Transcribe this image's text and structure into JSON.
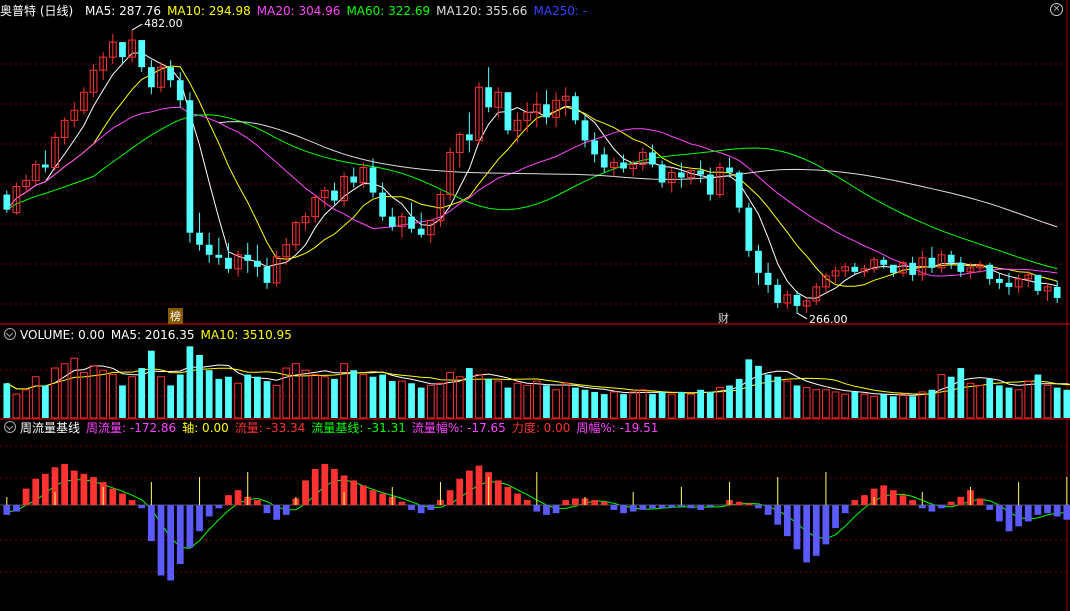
{
  "price_panel": {
    "title": "奥普特 (日线)",
    "ma": [
      {
        "label": "MA5: 287.76",
        "color": "#ffffff"
      },
      {
        "label": "MA10: 294.98",
        "color": "#ffff00"
      },
      {
        "label": "MA20: 304.96",
        "color": "#ff44ff"
      },
      {
        "label": "MA60: 322.69",
        "color": "#00ff00"
      },
      {
        "label": "MA120: 355.66",
        "color": "#dddddd"
      },
      {
        "label": "MA250: -",
        "color": "#3344ff"
      }
    ],
    "high_label": "482.00",
    "low_label": "266.00",
    "tag_bang": "榜",
    "tag_cai": "财"
  },
  "volume_panel": {
    "items": [
      {
        "label": "VOLUME: 0.00",
        "color": "#ffffff"
      },
      {
        "label": "MA5: 2016.35",
        "color": "#ffffff"
      },
      {
        "label": "MA10: 3510.95",
        "color": "#ffff00"
      }
    ]
  },
  "indicator_panel": {
    "title": "周流量基线",
    "items": [
      {
        "label": "周流量: -172.86",
        "color": "#ff44ff"
      },
      {
        "label": "轴: 0.00",
        "color": "#ffff00"
      },
      {
        "label": "流量: -33.34",
        "color": "#ff3333"
      },
      {
        "label": "流量基线: -31.31",
        "color": "#00ff00"
      },
      {
        "label": "流量幅%: -17.65",
        "color": "#ff44ff"
      },
      {
        "label": "力度: 0.00",
        "color": "#ff3333"
      },
      {
        "label": "周幅%: -19.51",
        "color": "#ff44ff"
      }
    ]
  },
  "colors": {
    "up": "#ff3232",
    "down": "#54ffff",
    "grid": "#7a0000",
    "divider": "#a00000"
  },
  "chart_data": [
    {
      "type": "candlestick",
      "name": "price",
      "ohlc": [
        [
          318,
          322,
          300,
          303
        ],
        [
          300,
          330,
          298,
          326
        ],
        [
          326,
          338,
          320,
          332
        ],
        [
          332,
          352,
          328,
          348
        ],
        [
          348,
          362,
          340,
          345
        ],
        [
          345,
          380,
          342,
          375
        ],
        [
          375,
          395,
          368,
          392
        ],
        [
          392,
          410,
          385,
          402
        ],
        [
          402,
          425,
          398,
          420
        ],
        [
          420,
          448,
          415,
          442
        ],
        [
          442,
          460,
          432,
          455
        ],
        [
          455,
          478,
          448,
          470
        ],
        [
          470,
          468,
          448,
          455
        ],
        [
          455,
          482,
          450,
          472
        ],
        [
          472,
          470,
          440,
          445
        ],
        [
          445,
          452,
          418,
          425
        ],
        [
          425,
          450,
          420,
          445
        ],
        [
          445,
          452,
          425,
          432
        ],
        [
          432,
          440,
          405,
          412
        ],
        [
          412,
          420,
          270,
          280
        ],
        [
          280,
          300,
          262,
          268
        ],
        [
          268,
          280,
          250,
          258
        ],
        [
          258,
          275,
          248,
          255
        ],
        [
          255,
          270,
          240,
          244
        ],
        [
          244,
          262,
          236,
          258
        ],
        [
          258,
          270,
          240,
          252
        ],
        [
          252,
          268,
          236,
          246
        ],
        [
          246,
          255,
          224,
          230
        ],
        [
          230,
          262,
          226,
          256
        ],
        [
          256,
          275,
          248,
          268
        ],
        [
          268,
          292,
          262,
          290
        ],
        [
          290,
          300,
          282,
          296
        ],
        [
          296,
          318,
          290,
          315
        ],
        [
          315,
          326,
          305,
          322
        ],
        [
          322,
          330,
          308,
          312
        ],
        [
          312,
          340,
          306,
          336
        ],
        [
          336,
          345,
          325,
          330
        ],
        [
          330,
          350,
          325,
          345
        ],
        [
          345,
          354,
          315,
          320
        ],
        [
          320,
          330,
          292,
          296
        ],
        [
          296,
          305,
          282,
          286
        ],
        [
          286,
          300,
          275,
          296
        ],
        [
          296,
          310,
          280,
          284
        ],
        [
          284,
          300,
          275,
          278
        ],
        [
          278,
          290,
          270,
          292
        ],
        [
          292,
          322,
          286,
          318
        ],
        [
          318,
          365,
          312,
          360
        ],
        [
          360,
          380,
          345,
          378
        ],
        [
          378,
          400,
          360,
          372
        ],
        [
          372,
          430,
          368,
          425
        ],
        [
          425,
          445,
          400,
          405
        ],
        [
          405,
          425,
          395,
          420
        ],
        [
          420,
          420,
          378,
          382
        ],
        [
          382,
          400,
          370,
          392
        ],
        [
          392,
          410,
          380,
          400
        ],
        [
          400,
          420,
          385,
          408
        ],
        [
          408,
          422,
          388,
          395
        ],
        [
          395,
          420,
          385,
          412
        ],
        [
          412,
          425,
          396,
          416
        ],
        [
          416,
          420,
          388,
          392
        ],
        [
          392,
          398,
          365,
          372
        ],
        [
          372,
          380,
          350,
          358
        ],
        [
          358,
          365,
          340,
          345
        ],
        [
          345,
          355,
          336,
          350
        ],
        [
          350,
          358,
          340,
          344
        ],
        [
          344,
          352,
          336,
          348
        ],
        [
          348,
          365,
          342,
          360
        ],
        [
          360,
          368,
          345,
          348
        ],
        [
          348,
          352,
          325,
          330
        ],
        [
          330,
          345,
          320,
          340
        ],
        [
          340,
          350,
          325,
          335
        ],
        [
          335,
          345,
          328,
          342
        ],
        [
          342,
          352,
          330,
          338
        ],
        [
          338,
          345,
          312,
          318
        ],
        [
          318,
          350,
          315,
          345
        ],
        [
          345,
          355,
          335,
          340
        ],
        [
          340,
          342,
          300,
          305
        ],
        [
          305,
          310,
          256,
          262
        ],
        [
          262,
          268,
          228,
          240
        ],
        [
          240,
          250,
          220,
          228
        ],
        [
          228,
          234,
          205,
          210
        ],
        [
          210,
          222,
          204,
          218
        ],
        [
          218,
          222,
          200,
          207
        ],
        [
          207,
          215,
          200,
          212
        ],
        [
          212,
          230,
          208,
          226
        ],
        [
          226,
          240,
          220,
          237
        ],
        [
          237,
          246,
          230,
          242
        ],
        [
          242,
          250,
          236,
          246
        ],
        [
          246,
          250,
          238,
          241
        ],
        [
          241,
          248,
          236,
          244
        ],
        [
          244,
          256,
          240,
          253
        ],
        [
          253,
          256,
          244,
          248
        ],
        [
          248,
          246,
          236,
          240
        ],
        [
          240,
          252,
          236,
          250
        ],
        [
          250,
          256,
          232,
          238
        ],
        [
          238,
          262,
          232,
          255
        ],
        [
          255,
          266,
          240,
          245
        ],
        [
          245,
          262,
          240,
          258
        ],
        [
          258,
          262,
          244,
          250
        ],
        [
          250,
          256,
          236,
          241
        ],
        [
          241,
          250,
          234,
          245
        ],
        [
          245,
          252,
          240,
          248
        ],
        [
          248,
          250,
          228,
          234
        ],
        [
          234,
          240,
          224,
          230
        ],
        [
          230,
          240,
          218,
          226
        ],
        [
          226,
          238,
          220,
          234
        ],
        [
          234,
          242,
          226,
          238
        ],
        [
          238,
          236,
          218,
          222
        ],
        [
          222,
          230,
          212,
          226
        ],
        [
          226,
          232,
          210,
          215
        ]
      ],
      "high_label": 482.0,
      "low_label": 266.0
    },
    {
      "type": "bar",
      "name": "volume",
      "values": [
        32,
        22,
        26,
        38,
        30,
        46,
        50,
        55,
        42,
        48,
        44,
        40,
        30,
        38,
        46,
        62,
        38,
        30,
        40,
        66,
        58,
        44,
        36,
        38,
        32,
        40,
        38,
        34,
        30,
        46,
        50,
        44,
        40,
        38,
        36,
        50,
        44,
        40,
        38,
        40,
        34,
        34,
        32,
        28,
        30,
        32,
        42,
        38,
        46,
        40,
        36,
        34,
        28,
        32,
        30,
        34,
        30,
        26,
        32,
        28,
        26,
        24,
        22,
        24,
        22,
        24,
        26,
        22,
        24,
        22,
        24,
        22,
        26,
        24,
        28,
        30,
        36,
        54,
        48,
        40,
        38,
        34,
        30,
        28,
        26,
        26,
        24,
        22,
        24,
        22,
        20,
        22,
        20,
        22,
        20,
        24,
        26,
        40,
        38,
        46,
        32,
        30,
        36,
        30,
        28,
        26,
        34,
        40,
        30,
        28,
        26,
        24
      ]
    },
    {
      "type": "bar",
      "name": "weekly-flow",
      "values": [
        -12,
        -8,
        20,
        32,
        38,
        46,
        50,
        42,
        38,
        34,
        28,
        20,
        14,
        6,
        -4,
        -44,
        -86,
        -92,
        -72,
        -52,
        -32,
        -14,
        -4,
        12,
        18,
        10,
        6,
        -10,
        -18,
        -12,
        8,
        30,
        44,
        50,
        44,
        36,
        30,
        24,
        18,
        14,
        10,
        4,
        -6,
        -10,
        -6,
        6,
        18,
        32,
        42,
        48,
        40,
        30,
        22,
        14,
        6,
        -8,
        -12,
        -10,
        6,
        8,
        8,
        6,
        4,
        -6,
        -10,
        -8,
        -6,
        -4,
        -4,
        -3,
        -2,
        -4,
        -6,
        -2,
        0,
        6,
        4,
        2,
        -4,
        -12,
        -24,
        -38,
        -54,
        -70,
        -62,
        -48,
        -28,
        -10,
        6,
        12,
        20,
        24,
        18,
        12,
        6,
        -4,
        -8,
        -4,
        4,
        10,
        18,
        8,
        -6,
        -20,
        -32,
        -26,
        -20,
        -12,
        -10,
        -14,
        -18,
        -14
      ]
    }
  ]
}
